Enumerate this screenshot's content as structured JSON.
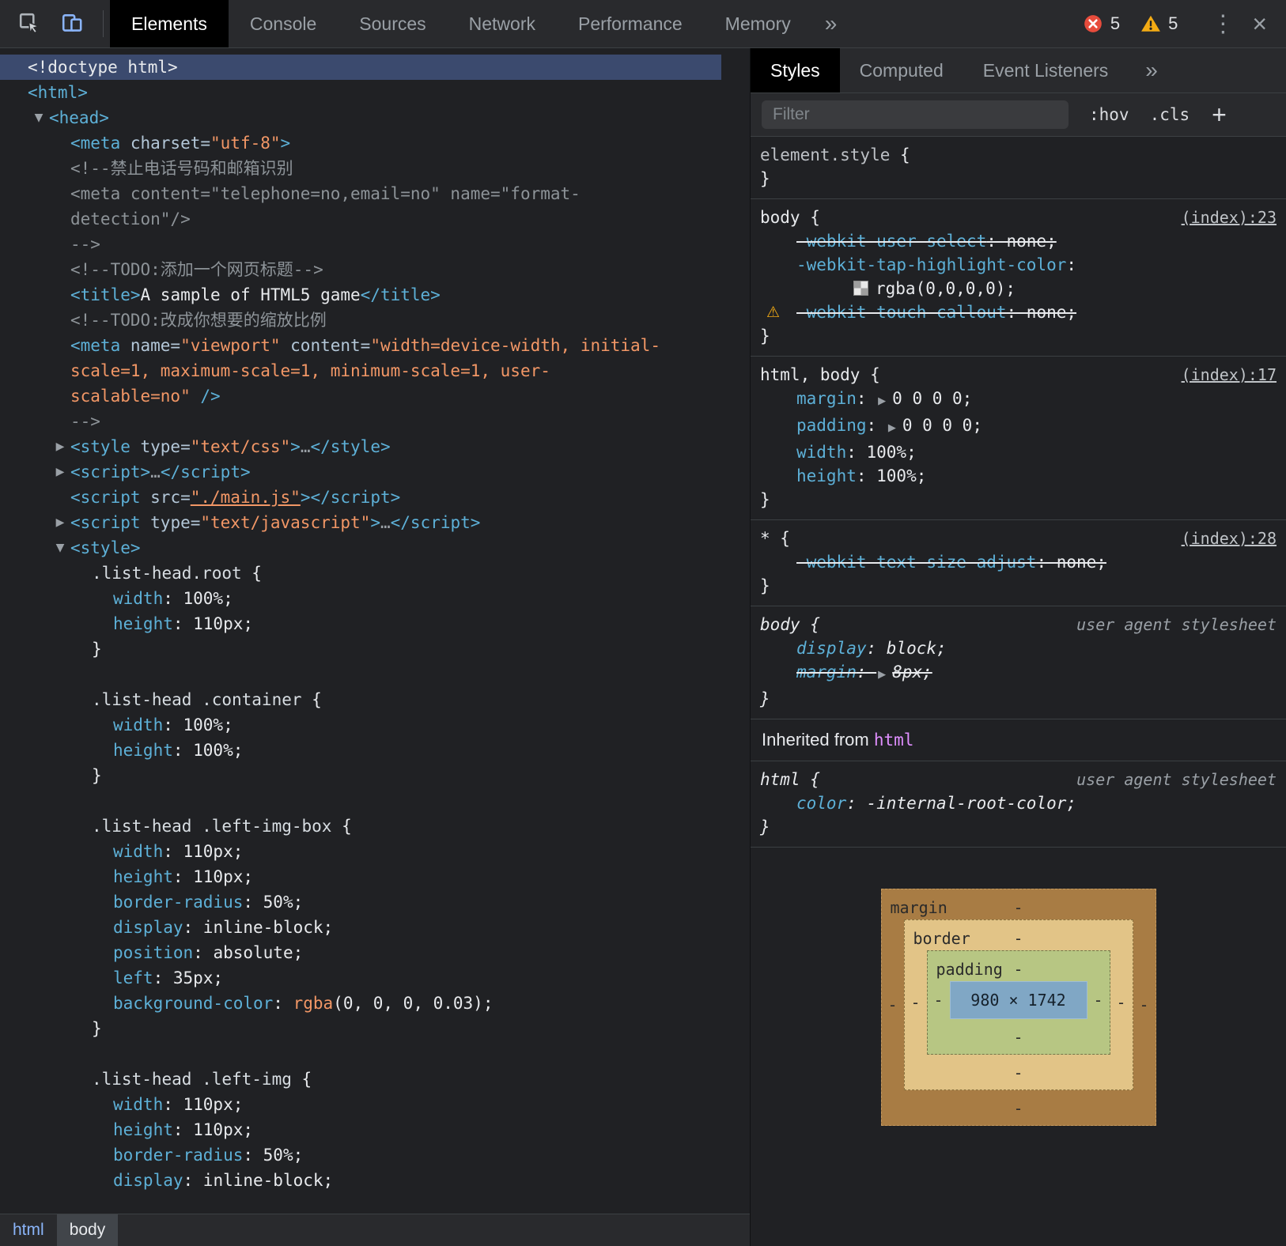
{
  "toolbar": {
    "tabs": [
      "Elements",
      "Console",
      "Sources",
      "Network",
      "Performance",
      "Memory"
    ],
    "active_tab": "Elements",
    "error_count": "5",
    "warning_count": "5"
  },
  "icons": {
    "tree_expanded": "▼",
    "tree_collapsed": "▶",
    "more_tabs": "»",
    "styles_more": "»",
    "kebab": "⋮",
    "close": "×",
    "plus": "+",
    "warning_glyph": "⚠",
    "shorthand_arrow": "▶"
  },
  "colors": {
    "selection": "#3b4a6e",
    "error_red": "#e74c3c",
    "warning_yellow": "#f3ab14",
    "tag_blue": "#5db0d7",
    "value_orange": "#f29766",
    "inherited_link_pink": "#e08fff"
  },
  "elements_panel": {
    "breadcrumb": [
      {
        "label": "html",
        "selected": false
      },
      {
        "label": "body",
        "selected": true
      }
    ],
    "lines": [
      {
        "indent": 0,
        "sel": true,
        "tok": [
          [
            "p",
            "<!doctype html>"
          ]
        ]
      },
      {
        "indent": 0,
        "tok": [
          [
            "t",
            "<html>"
          ]
        ]
      },
      {
        "indent": 1,
        "arrow": "v",
        "tok": [
          [
            "t",
            "<head>"
          ]
        ]
      },
      {
        "indent": 2,
        "tok": [
          [
            "t",
            "<meta"
          ],
          [
            "a",
            " charset="
          ],
          [
            "v",
            "\"utf-8\""
          ],
          [
            "t",
            ">"
          ]
        ]
      },
      {
        "indent": 2,
        "tok": [
          [
            "c",
            "<!--禁止电话号码和邮箱识别"
          ]
        ]
      },
      {
        "indent": 2,
        "tok": [
          [
            "c",
            "<meta content=\"telephone=no,email=no\" name=\"format-"
          ]
        ]
      },
      {
        "indent": 2,
        "tok": [
          [
            "c",
            "detection\"/>"
          ]
        ]
      },
      {
        "indent": 2,
        "tok": [
          [
            "c",
            "-->"
          ]
        ]
      },
      {
        "indent": 2,
        "tok": [
          [
            "c",
            "<!--TODO:添加一个网页标题-->"
          ]
        ]
      },
      {
        "indent": 2,
        "tok": [
          [
            "t",
            "<title>"
          ],
          [
            "p",
            "A sample of HTML5 game"
          ],
          [
            "t",
            "</title>"
          ]
        ]
      },
      {
        "indent": 2,
        "tok": [
          [
            "c",
            "<!--TODO:改成你想要的缩放比例"
          ]
        ]
      },
      {
        "indent": 2,
        "tok": [
          [
            "t",
            "<meta"
          ],
          [
            "a",
            " name="
          ],
          [
            "v",
            "\"viewport\""
          ],
          [
            "a",
            " content="
          ],
          [
            "v",
            "\"width=device-width, initial-"
          ]
        ]
      },
      {
        "indent": 2,
        "tok": [
          [
            "v",
            "scale=1, maximum-scale=1, minimum-scale=1, user-"
          ]
        ]
      },
      {
        "indent": 2,
        "tok": [
          [
            "v",
            "scalable=no\" "
          ],
          [
            "t",
            "/>"
          ]
        ]
      },
      {
        "indent": 2,
        "tok": [
          [
            "c",
            "-->"
          ]
        ]
      },
      {
        "indent": 2,
        "arrow": ">",
        "tok": [
          [
            "t",
            "<style"
          ],
          [
            "a",
            " type="
          ],
          [
            "v",
            "\"text/css\""
          ],
          [
            "t",
            ">"
          ],
          [
            "e",
            "…"
          ],
          [
            "t",
            "</style>"
          ]
        ]
      },
      {
        "indent": 2,
        "arrow": ">",
        "tok": [
          [
            "t",
            "<script>"
          ],
          [
            "e",
            "…"
          ],
          [
            "t",
            "</script>"
          ]
        ]
      },
      {
        "indent": 2,
        "tok": [
          [
            "t",
            "<script"
          ],
          [
            "a",
            " src="
          ],
          [
            "vl",
            "\"./main.js\""
          ],
          [
            "t",
            "></script>"
          ]
        ]
      },
      {
        "indent": 2,
        "arrow": ">",
        "tok": [
          [
            "t",
            "<script"
          ],
          [
            "a",
            " type="
          ],
          [
            "v",
            "\"text/javascript\""
          ],
          [
            "t",
            ">"
          ],
          [
            "e",
            "…"
          ],
          [
            "t",
            "</script>"
          ]
        ]
      },
      {
        "indent": 2,
        "arrow": "v",
        "tok": [
          [
            "t",
            "<style>"
          ]
        ]
      },
      {
        "indent": 3,
        "tok": [
          [
            "s",
            ".list-head.root "
          ],
          [
            "p",
            "{"
          ]
        ]
      },
      {
        "indent": 4,
        "tok": [
          [
            "k",
            "width"
          ],
          [
            "p",
            ": 100%;"
          ]
        ]
      },
      {
        "indent": 4,
        "tok": [
          [
            "k",
            "height"
          ],
          [
            "p",
            ": 110px;"
          ]
        ]
      },
      {
        "indent": 3,
        "tok": [
          [
            "p",
            "}"
          ]
        ]
      },
      {
        "indent": 0,
        "tok": []
      },
      {
        "indent": 3,
        "tok": [
          [
            "s",
            ".list-head .container "
          ],
          [
            "p",
            "{"
          ]
        ]
      },
      {
        "indent": 4,
        "tok": [
          [
            "k",
            "width"
          ],
          [
            "p",
            ": 100%;"
          ]
        ]
      },
      {
        "indent": 4,
        "tok": [
          [
            "k",
            "height"
          ],
          [
            "p",
            ": 100%;"
          ]
        ]
      },
      {
        "indent": 3,
        "tok": [
          [
            "p",
            "}"
          ]
        ]
      },
      {
        "indent": 0,
        "tok": []
      },
      {
        "indent": 3,
        "tok": [
          [
            "s",
            ".list-head .left-img-box "
          ],
          [
            "p",
            "{"
          ]
        ]
      },
      {
        "indent": 4,
        "tok": [
          [
            "k",
            "width"
          ],
          [
            "p",
            ": 110px;"
          ]
        ]
      },
      {
        "indent": 4,
        "tok": [
          [
            "k",
            "height"
          ],
          [
            "p",
            ": 110px;"
          ]
        ]
      },
      {
        "indent": 4,
        "tok": [
          [
            "k",
            "border-radius"
          ],
          [
            "p",
            ": 50%;"
          ]
        ]
      },
      {
        "indent": 4,
        "tok": [
          [
            "k",
            "display"
          ],
          [
            "p",
            ": inline-block;"
          ]
        ]
      },
      {
        "indent": 4,
        "tok": [
          [
            "k",
            "position"
          ],
          [
            "p",
            ": absolute;"
          ]
        ]
      },
      {
        "indent": 4,
        "tok": [
          [
            "k",
            "left"
          ],
          [
            "p",
            ": 35px;"
          ]
        ]
      },
      {
        "indent": 4,
        "tok": [
          [
            "k",
            "background-color"
          ],
          [
            "p",
            ": "
          ],
          [
            "f",
            "rgba"
          ],
          [
            "p",
            "(0, 0, 0, 0.03);"
          ]
        ]
      },
      {
        "indent": 3,
        "tok": [
          [
            "p",
            "}"
          ]
        ]
      },
      {
        "indent": 0,
        "tok": []
      },
      {
        "indent": 3,
        "tok": [
          [
            "s",
            ".list-head .left-img "
          ],
          [
            "p",
            "{"
          ]
        ]
      },
      {
        "indent": 4,
        "tok": [
          [
            "k",
            "width"
          ],
          [
            "p",
            ": 110px;"
          ]
        ]
      },
      {
        "indent": 4,
        "tok": [
          [
            "k",
            "height"
          ],
          [
            "p",
            ": 110px;"
          ]
        ]
      },
      {
        "indent": 4,
        "tok": [
          [
            "k",
            "border-radius"
          ],
          [
            "p",
            ": 50%;"
          ]
        ]
      },
      {
        "indent": 4,
        "tok": [
          [
            "k",
            "display"
          ],
          [
            "p",
            ": inline-block;"
          ]
        ]
      }
    ]
  },
  "styles_panel": {
    "tabs": [
      "Styles",
      "Computed",
      "Event Listeners"
    ],
    "active_tab": "Styles",
    "filter_placeholder": "Filter",
    "hov_label": ":hov",
    "cls_label": ".cls",
    "sections": [
      {
        "kind": "rule",
        "selector": [
          [
            "gray",
            "element.style"
          ],
          [
            "p",
            " {"
          ]
        ],
        "rows": [],
        "close": "}"
      },
      {
        "kind": "rule",
        "selector": [
          [
            "sel",
            "body"
          ],
          [
            "p",
            " {"
          ]
        ],
        "link": "(index):23",
        "rows": [
          {
            "strike": true,
            "tok": [
              [
                "k",
                "-webkit-user-select"
              ],
              [
                "p",
                ": none;"
              ]
            ]
          },
          {
            "tok": [
              [
                "k",
                "-webkit-tap-highlight-color"
              ],
              [
                "p",
                ":"
              ]
            ]
          },
          {
            "wrap": true,
            "tok": [
              [
                "swatch",
                ""
              ],
              [
                "p",
                "rgba(0,0,0,0);"
              ]
            ]
          },
          {
            "strike": true,
            "warn": true,
            "tok": [
              [
                "k",
                "-webkit-touch-callout"
              ],
              [
                "p",
                ": none;"
              ]
            ]
          }
        ],
        "close": "}"
      },
      {
        "kind": "rule",
        "selector": [
          [
            "sel",
            "html, body"
          ],
          [
            "p",
            " {"
          ]
        ],
        "link": "(index):17",
        "rows": [
          {
            "tok": [
              [
                "k",
                "margin"
              ],
              [
                "p",
                ": "
              ],
              [
                "arr",
                ""
              ],
              [
                "p",
                "0 0 0 0;"
              ]
            ]
          },
          {
            "tok": [
              [
                "k",
                "padding"
              ],
              [
                "p",
                ": "
              ],
              [
                "arr",
                ""
              ],
              [
                "p",
                "0 0 0 0;"
              ]
            ]
          },
          {
            "tok": [
              [
                "k",
                "width"
              ],
              [
                "p",
                ": 100%;"
              ]
            ]
          },
          {
            "tok": [
              [
                "k",
                "height"
              ],
              [
                "p",
                ": 100%;"
              ]
            ]
          }
        ],
        "close": "}"
      },
      {
        "kind": "rule",
        "selector": [
          [
            "sel",
            "* "
          ],
          [
            "p",
            "{"
          ]
        ],
        "link": "(index):28",
        "rows": [
          {
            "strike": true,
            "tok": [
              [
                "k",
                "-webkit-text-size-adjust"
              ],
              [
                "p",
                ": none;"
              ]
            ]
          }
        ],
        "close": "}"
      },
      {
        "kind": "rule",
        "italic": true,
        "selector": [
          [
            "sel",
            "body"
          ],
          [
            "p",
            " {"
          ]
        ],
        "origin": "user agent stylesheet",
        "rows": [
          {
            "tok": [
              [
                "k",
                "display"
              ],
              [
                "p",
                ": block;"
              ]
            ]
          },
          {
            "strike": true,
            "tok": [
              [
                "k",
                "margin"
              ],
              [
                "p",
                ": "
              ],
              [
                "arr",
                ""
              ],
              [
                "p",
                "8px;"
              ]
            ]
          }
        ],
        "close": "}"
      },
      {
        "kind": "band",
        "label": "Inherited from ",
        "node": "html"
      },
      {
        "kind": "rule",
        "italic": true,
        "selector": [
          [
            "sel",
            "html"
          ],
          [
            "p",
            " {"
          ]
        ],
        "origin": "user agent stylesheet",
        "rows": [
          {
            "tok": [
              [
                "k",
                "color"
              ],
              [
                "p",
                ": -internal-root-color;"
              ]
            ]
          }
        ],
        "close": "}"
      }
    ],
    "box_model": {
      "margin_label": "margin",
      "border_label": "border",
      "padding_label": "padding",
      "dash": "-",
      "content": "980 × 1742"
    }
  }
}
